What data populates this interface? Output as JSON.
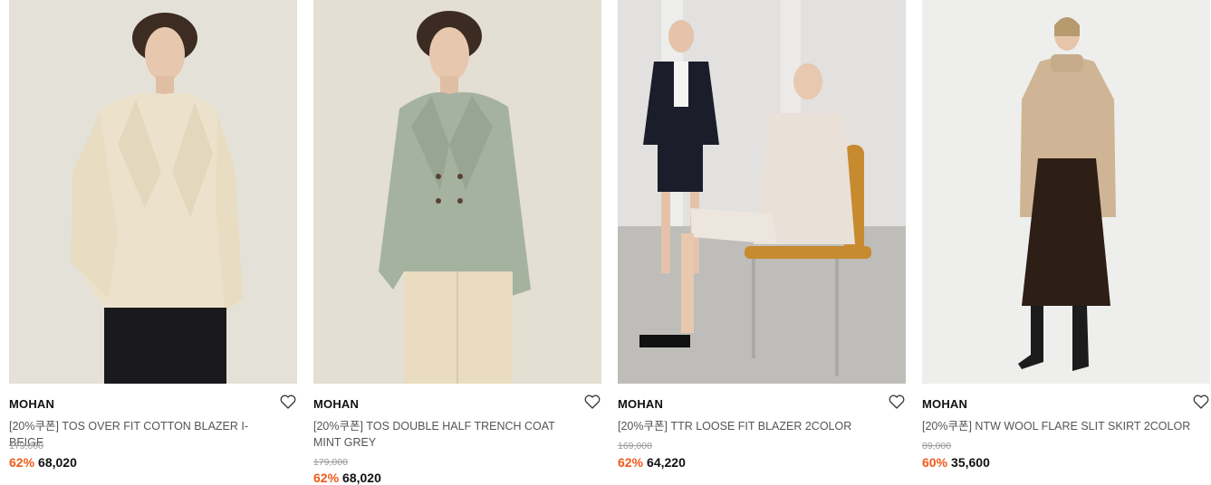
{
  "products": [
    {
      "brand": "MOHAN",
      "name": "[20%쿠폰] TOS OVER FIT COTTON BLAZER I-BEIGE",
      "original_price": "179,000",
      "discount": "62%",
      "sale_price": "68,020",
      "image_alt": "model in beige oversized cotton blazer"
    },
    {
      "brand": "MOHAN",
      "name": "[20%쿠폰] TOS DOUBLE HALF TRENCH COAT MINT GREY",
      "original_price": "179,000",
      "discount": "62%",
      "sale_price": "68,020",
      "image_alt": "model in mint grey double half trench coat"
    },
    {
      "brand": "MOHAN",
      "name": "[20%쿠폰] TTR LOOSE FIT BLAZER 2COLOR",
      "original_price": "169,000",
      "discount": "62%",
      "sale_price": "64,220",
      "image_alt": "two models in loose fit blazers with chair"
    },
    {
      "brand": "MOHAN",
      "name": "[20%쿠폰] NTW WOOL FLARE SLIT SKIRT 2COLOR",
      "original_price": "89,000",
      "discount": "60%",
      "sale_price": "35,600",
      "image_alt": "model in beige knit and brown wool flare skirt"
    }
  ],
  "icons": {
    "wishlist": "heart-outline-icon"
  },
  "colors": {
    "discount": "#f05a19",
    "text": "#111111",
    "muted": "#9a9a9a"
  }
}
